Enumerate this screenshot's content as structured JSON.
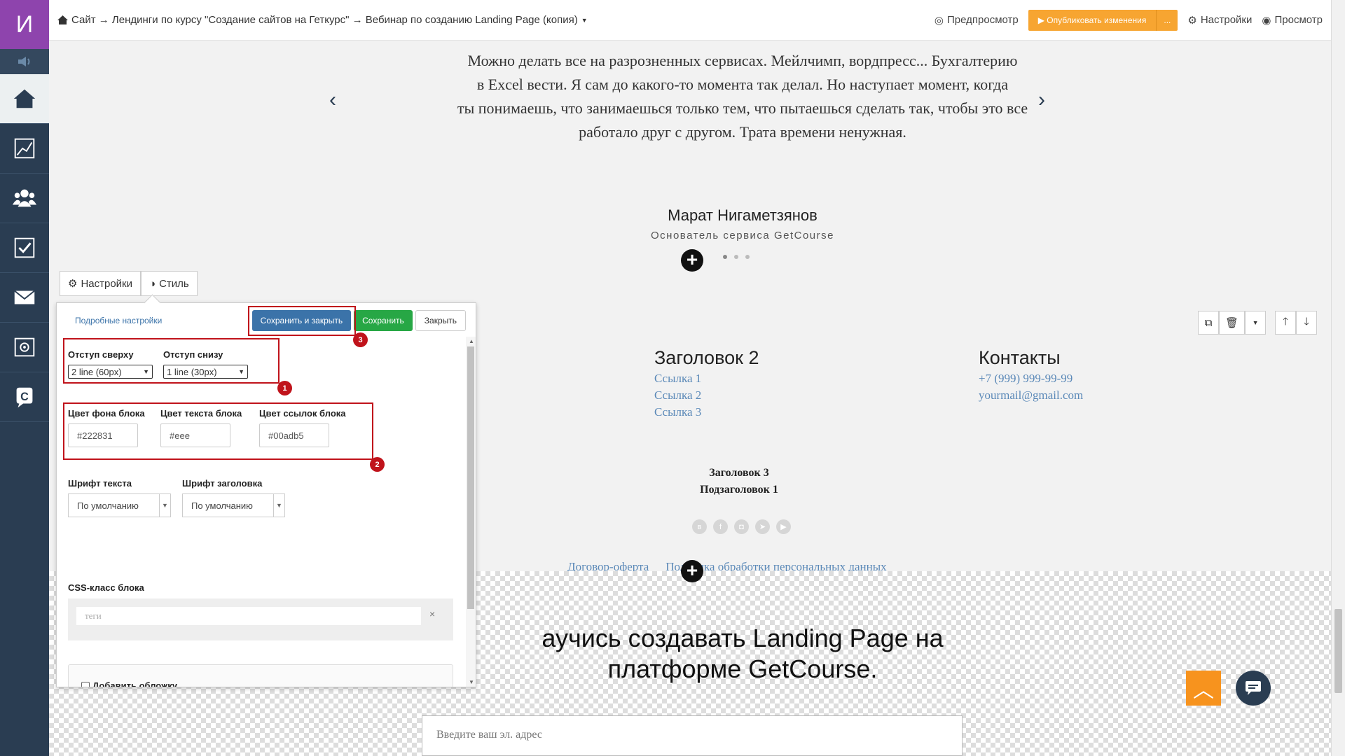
{
  "sidebar": {
    "logo_letter": "И"
  },
  "topbar": {
    "breadcrumb": "Сайт → Лендинги по курсу \"Создание сайтов на Геткурс\" → Вебинар по созданию Landing Page (копия)",
    "preview": "Предпросмотр",
    "publish": "▶ Опубликовать изменения",
    "publish_more": "...",
    "settings": "Настройки",
    "view": "Просмотр"
  },
  "testimonial": {
    "lines": [
      "Можно делать все на разрозненных сервисах. Мейлчимп, вордпресс... Бухгалтерию",
      "в Excel вести. Я сам до какого-то момента так делал. Но наступает момент, когда",
      "ты понимаешь, что занимаешься только тем, что пытаешься сделать так, чтобы это все",
      "работало друг с другом. Трата времени ненужная."
    ],
    "author": "Марат Нигаметзянов",
    "role": "Основатель сервиса GetCourse"
  },
  "footer": {
    "col2_title": "Заголовок 2",
    "col2_links": [
      "Ссылка 1",
      "Ссылка 2",
      "Ссылка 3"
    ],
    "col3_title": "Контакты",
    "phone": "+7 (999) 999-99-99",
    "email": "yourmail@gmail.com",
    "h3": "Заголовок 3",
    "subheading": "Подзаголовок 1",
    "offer": "Договор-оферта",
    "privacy": "Политика обработки персональных данных"
  },
  "promo": {
    "line1": "аучись создавать Landing Page на",
    "line2": "платформе GetCourse.",
    "email_placeholder": "Введите ваш эл. адрес"
  },
  "tabs": {
    "settings": "Настройки",
    "style": "Стиль"
  },
  "panel": {
    "advanced": "Подробные настройки",
    "save_close": "Сохранить и закрыть",
    "save": "Сохранить",
    "close": "Закрыть",
    "padding_top_label": "Отступ сверху",
    "padding_top_value": "2 line (60px)",
    "padding_bottom_label": "Отступ снизу",
    "padding_bottom_value": "1 line (30px)",
    "bg_color_label": "Цвет фона блока",
    "bg_color_value": "#222831",
    "text_color_label": "Цвет текста блока",
    "text_color_value": "#eee",
    "link_color_label": "Цвет ссылок блока",
    "link_color_value": "#00adb5",
    "text_font_label": "Шрифт текста",
    "text_font_value": "По умолчанию",
    "heading_font_label": "Шрифт заголовка",
    "heading_font_value": "По умолчанию",
    "css_label": "CSS-класс блока",
    "tags_placeholder": "теги",
    "tags_clear": "×",
    "cover_label": "Добавить обложку"
  },
  "annotations": {
    "badge1": "1",
    "badge2": "2",
    "badge3": "3"
  },
  "colors": {
    "sidebar": "#2a3d52",
    "logo": "#8e44ad",
    "publish": "#f7a531",
    "save_close": "#3b73a9",
    "save": "#27a745",
    "annotation": "#c0131b",
    "link": "#5b89b8"
  }
}
